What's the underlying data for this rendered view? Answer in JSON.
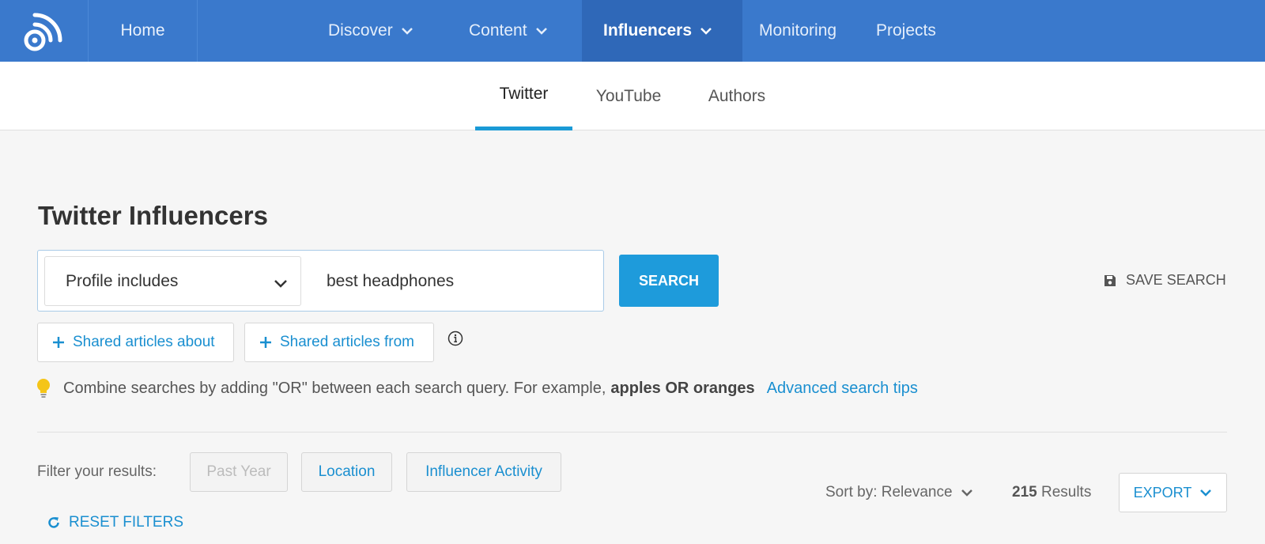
{
  "nav": {
    "logo_icon": "rss-logo-icon",
    "home": "Home",
    "discover": "Discover",
    "content": "Content",
    "influencers": "Influencers",
    "monitoring": "Monitoring",
    "projects": "Projects",
    "active": "Influencers"
  },
  "subnav": {
    "tabs": [
      "Twitter",
      "YouTube",
      "Authors"
    ],
    "active": "Twitter"
  },
  "page": {
    "title": "Twitter Influencers"
  },
  "search": {
    "select_value": "Profile includes",
    "query": "best headphones",
    "button": "SEARCH",
    "save": "SAVE SEARCH",
    "chip_about": "Shared articles about",
    "chip_from": "Shared articles from"
  },
  "tip": {
    "text": "Combine searches by adding \"OR\" between each search query. For example,",
    "example": "apples OR oranges",
    "link": "Advanced search tips"
  },
  "filters": {
    "label": "Filter your results:",
    "past_year": "Past Year",
    "location": "Location",
    "activity": "Influencer Activity",
    "reset": "RESET FILTERS"
  },
  "results": {
    "sort": "Sort by: Relevance",
    "count": "215",
    "label": "Results",
    "export": "EXPORT"
  },
  "colors": {
    "nav_bg": "#3a79cc",
    "nav_active": "#2f68b8",
    "accent": "#1e9bdb",
    "link": "#1a8fd0",
    "bulb": "#f5c518"
  }
}
